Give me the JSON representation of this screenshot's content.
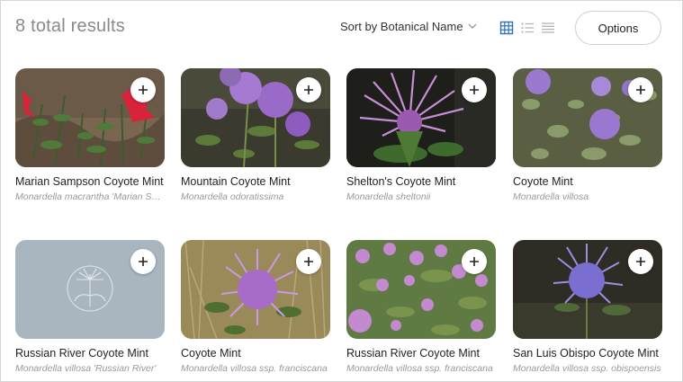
{
  "header": {
    "results_label": "8 total results",
    "sort_label": "Sort by Botanical Name",
    "options_label": "Options",
    "view_icons": [
      "grid-view-icon",
      "list-view-icon",
      "compact-list-icon"
    ],
    "active_view": "grid",
    "accent_color": "#2f6fb0"
  },
  "results": [
    {
      "common_name": "Marian Sampson Coyote Mint",
      "botanical_name": "Monardella macrantha 'Marian Sampson'",
      "image": "photo"
    },
    {
      "common_name": "Mountain Coyote Mint",
      "botanical_name": "Monardella odoratissima",
      "image": "photo"
    },
    {
      "common_name": "Shelton's Coyote Mint",
      "botanical_name": "Monardella sheltonii",
      "image": "photo"
    },
    {
      "common_name": "Coyote Mint",
      "botanical_name": "Monardella villosa",
      "image": "photo"
    },
    {
      "common_name": "Russian River Coyote Mint",
      "botanical_name": "Monardella villosa 'Russian River'",
      "image": "placeholder"
    },
    {
      "common_name": "Coyote Mint",
      "botanical_name": "Monardella villosa ssp. franciscana",
      "image": "photo"
    },
    {
      "common_name": "Russian River Coyote Mint",
      "botanical_name": "Monardella villosa ssp. franciscana",
      "image": "photo"
    },
    {
      "common_name": "San Luis Obispo Coyote Mint",
      "botanical_name": "Monardella villosa ssp. obispoensis",
      "image": "photo"
    }
  ]
}
